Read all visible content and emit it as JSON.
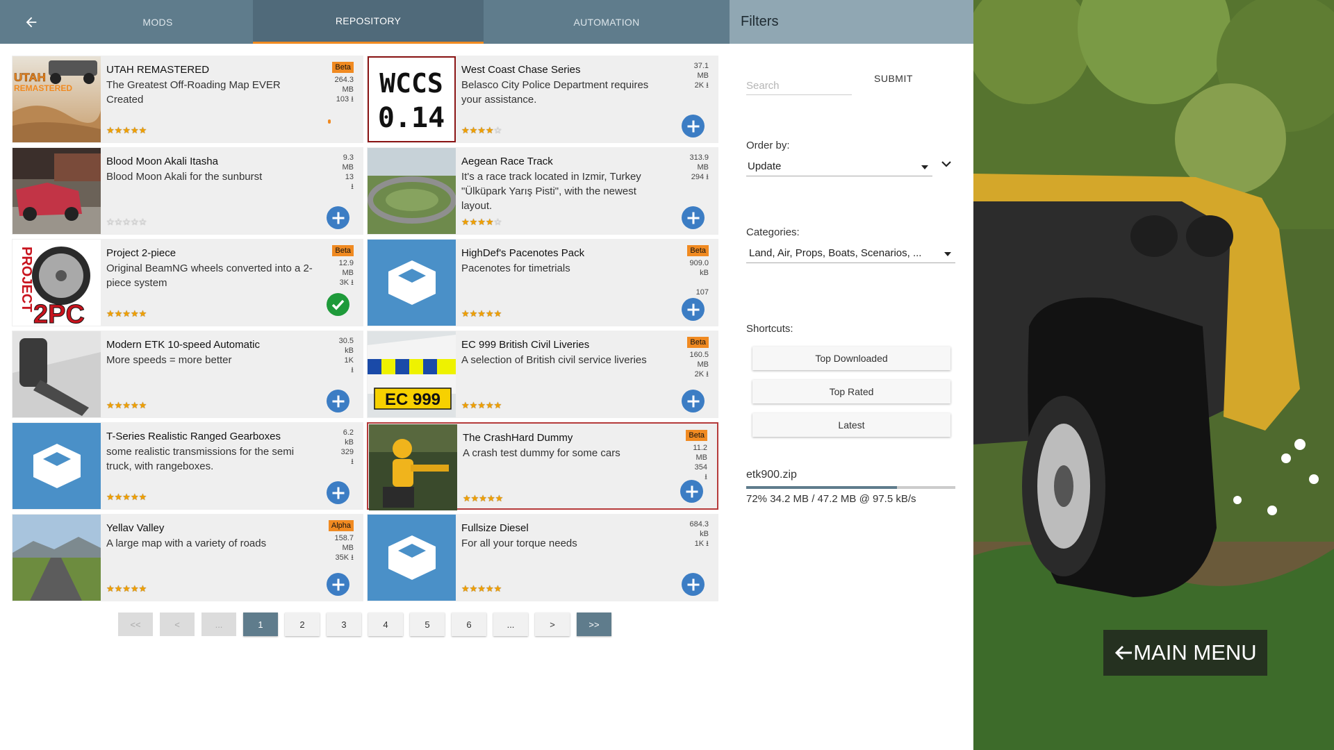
{
  "header": {
    "tabs": [
      {
        "label": "MODS",
        "active": false
      },
      {
        "label": "REPOSITORY",
        "active": true
      },
      {
        "label": "AUTOMATION",
        "active": false
      }
    ],
    "back_icon": "arrow-left-icon",
    "accent_color": "#f08a21",
    "bar_color": "#5f7c8c"
  },
  "mods": [
    {
      "title": "UTAH REMASTERED",
      "desc": "The Greatest Off-Roading Map EVER Created",
      "badge": "Beta",
      "size_num": "264.3",
      "size_unit": "MB",
      "downloads": "103",
      "rating": 5,
      "action": "downloading"
    },
    {
      "title": "West Coast Chase Series",
      "desc": "Belasco City Police Department requires your assistance.",
      "badge": "",
      "size_num": "37.1",
      "size_unit": "MB",
      "downloads": "2K",
      "rating": 4.5,
      "action": "add"
    },
    {
      "title": "Blood Moon Akali Itasha",
      "desc": "Blood Moon Akali for the sunburst",
      "badge": "",
      "size_num": "9.3",
      "size_unit": "MB",
      "downloads": "13",
      "rating": 0,
      "action": "add"
    },
    {
      "title": "Aegean Race Track",
      "desc": "It's a race track located in Izmir, Turkey \"Ülküpark Yarış Pisti\", with the newest layout.",
      "badge": "",
      "size_num": "313.9",
      "size_unit": "MB",
      "downloads": "294",
      "rating": 4.5,
      "action": "add"
    },
    {
      "title": "Project 2-piece",
      "desc": "Original BeamNG wheels converted into a 2-piece system",
      "badge": "Beta",
      "size_num": "12.9",
      "size_unit": "MB",
      "downloads": "3K",
      "rating": 5,
      "action": "installed"
    },
    {
      "title": "HighDef's Pacenotes Pack",
      "desc": "Pacenotes for timetrials",
      "badge": "Beta",
      "size_num": "909.0",
      "size_unit": "kB",
      "downloads": "107",
      "rating": 5,
      "action": "add"
    },
    {
      "title": "Modern ETK 10-speed Automatic",
      "desc": "More speeds = more better",
      "badge": "",
      "size_num": "30.5",
      "size_unit": "kB",
      "downloads": "1K",
      "rating": 5,
      "action": "add"
    },
    {
      "title": "EC 999 British Civil Liveries",
      "desc": "A selection of British civil service liveries",
      "badge": "Beta",
      "size_num": "160.5",
      "size_unit": "MB",
      "downloads": "2K",
      "rating": 5,
      "action": "add"
    },
    {
      "title": "T-Series Realistic Ranged Gearboxes",
      "desc": "some realistic transmissions for the semi truck, with rangeboxes.",
      "badge": "",
      "size_num": "6.2",
      "size_unit": "kB",
      "downloads": "329",
      "rating": 5,
      "action": "add"
    },
    {
      "title": "The CrashHard Dummy",
      "desc": "A crash test dummy for some cars",
      "badge": "Beta",
      "size_num": "11.2",
      "size_unit": "MB",
      "downloads": "354",
      "rating": 5,
      "action": "add",
      "selected": true
    },
    {
      "title": "Yellav Valley",
      "desc": "A large map with a variety of roads",
      "badge": "Alpha",
      "size_num": "158.7",
      "size_unit": "MB",
      "downloads": "35K",
      "rating": 5,
      "action": "add"
    },
    {
      "title": "Fullsize Diesel",
      "desc": "For all your torque needs",
      "badge": "",
      "size_num": "684.3",
      "size_unit": "kB",
      "downloads": "1K",
      "rating": 5,
      "action": "add"
    }
  ],
  "thumbs": {
    "wccs_line1": "WCCS",
    "wccs_line2": "0.14",
    "utah_logo_line1": "UTAH",
    "utah_logo_line2": "REMASTERED",
    "project_text": "PROJECT",
    "twopc_text": "2PC",
    "ec_plate": "EC 999"
  },
  "pager": {
    "first": "<<",
    "prev": "<",
    "ellipsis_left": "...",
    "pages": [
      "1",
      "2",
      "3",
      "4",
      "5",
      "6"
    ],
    "ellipsis_right": "...",
    "next": ">",
    "last": ">>",
    "current": "1"
  },
  "filters": {
    "title": "Filters",
    "search_placeholder": "Search",
    "submit_label": "SUBMIT",
    "order_label": "Order by:",
    "order_value": "Update",
    "categories_label": "Categories:",
    "categories_value": "Land, Air, Props, Boats, Scenarios, ...",
    "shortcuts_label": "Shortcuts:",
    "shortcuts": [
      "Top Downloaded",
      "Top Rated",
      "Latest"
    ],
    "download": {
      "file": "etk900.zip",
      "percent": 72,
      "status": "72% 34.2 MB / 47.2 MB @ 97.5 kB/s"
    }
  },
  "main_menu": {
    "label": "MAIN MENU",
    "icon": "arrow-left-icon"
  }
}
